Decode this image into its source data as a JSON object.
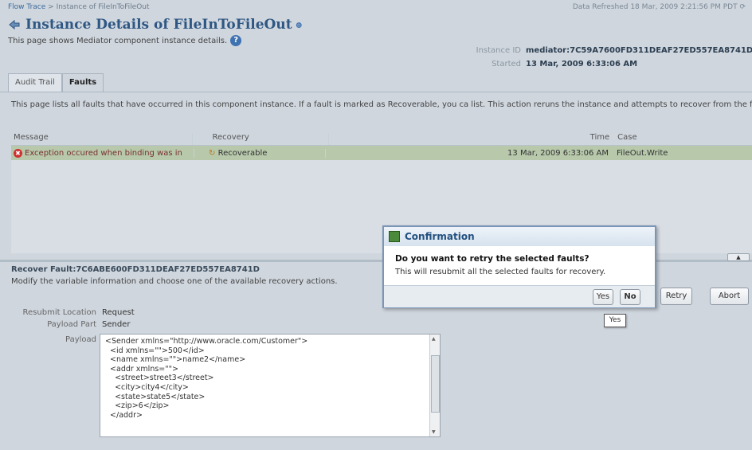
{
  "breadcrumb": {
    "link": "Flow Trace",
    "separator": ">",
    "current": "Instance of FileInToFileOut"
  },
  "refresh_text": "Data Refreshed 18 Mar, 2009 2:21:56 PM PDT",
  "title": "Instance Details of FileInToFileOut",
  "subtitle": "This page shows Mediator component instance details.",
  "instance": {
    "id_label": "Instance ID",
    "id_value": "mediator:7C59A7600FD311DEAF27ED557EA8741D",
    "started_label": "Started",
    "started_value": "13 Mar, 2009 6:33:06 AM"
  },
  "tabs": [
    "Audit Trail",
    "Faults"
  ],
  "faults_description": "This page lists all faults that have occurred in this component instance. If a fault is marked as Recoverable, you ca list. This action reruns the instance and attempts to recover from the fault.",
  "grid": {
    "headers": {
      "message": "Message",
      "recovery": "Recovery",
      "time": "Time",
      "case": "Case"
    },
    "rows": [
      {
        "message": "Exception occured when binding was in",
        "recovery": "Recoverable",
        "time": "13 Mar, 2009 6:33:06 AM",
        "case": "FileOut.Write"
      }
    ]
  },
  "recover": {
    "title": "Recover Fault:7C6ABE600FD311DEAF27ED557EA8741D",
    "description": "Modify the variable information and choose one of the available recovery actions.",
    "resubmit_label": "Resubmit Location",
    "resubmit_value": "Request",
    "payload_part_label": "Payload Part",
    "payload_part_value": "Sender",
    "payload_label": "Payload",
    "payload_text": "<Sender xmlns=\"http://www.oracle.com/Customer\">\n  <id xmlns=\"\">500</id>\n  <name xmlns=\"\">name2</name>\n  <addr xmlns=\"\">\n    <street>street3</street>\n    <city>city4</city>\n    <state>state5</state>\n    <zip>6</zip>\n  </addr>",
    "retry_label": "Retry",
    "abort_label": "Abort"
  },
  "dialog": {
    "title": "Confirmation",
    "question": "Do you want to retry the selected faults?",
    "message": "This will resubmit all the selected faults for recovery.",
    "yes_label": "Yes",
    "no_label": "No"
  },
  "tooltip": "Yes"
}
